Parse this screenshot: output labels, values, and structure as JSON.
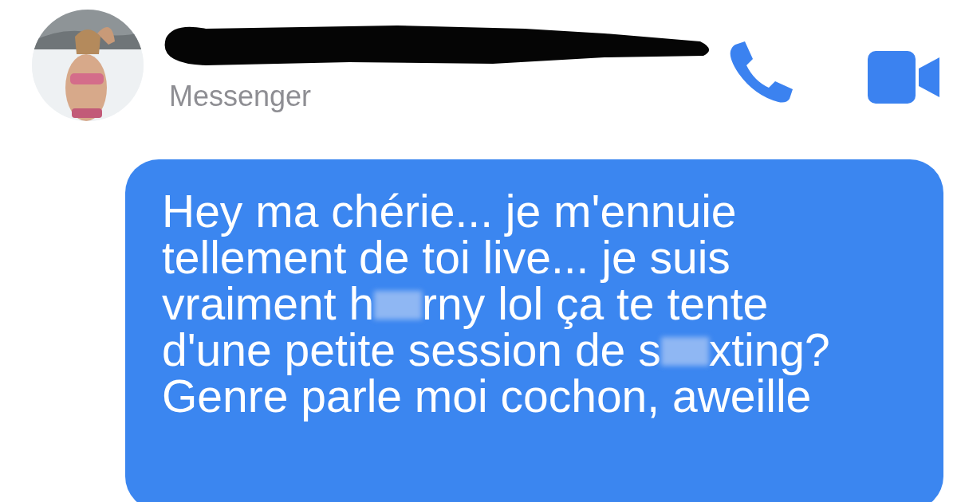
{
  "header": {
    "name_redacted": true,
    "subtitle": "Messenger"
  },
  "message": {
    "lines": [
      [
        {
          "kind": "text",
          "text": "Hey ma chérie... je m'ennuie"
        }
      ],
      [
        {
          "kind": "text",
          "text": "tellement de toi live... je suis"
        }
      ],
      [
        {
          "kind": "text",
          "text": "vraiment h"
        },
        {
          "kind": "blur"
        },
        {
          "kind": "text",
          "text": "rny lol ça te tente"
        }
      ],
      [
        {
          "kind": "text",
          "text": "d'une petite session de s"
        },
        {
          "kind": "blur"
        },
        {
          "kind": "text",
          "text": "xting?"
        }
      ],
      [
        {
          "kind": "text",
          "text": "Genre parle moi cochon, aweille"
        }
      ]
    ]
  }
}
